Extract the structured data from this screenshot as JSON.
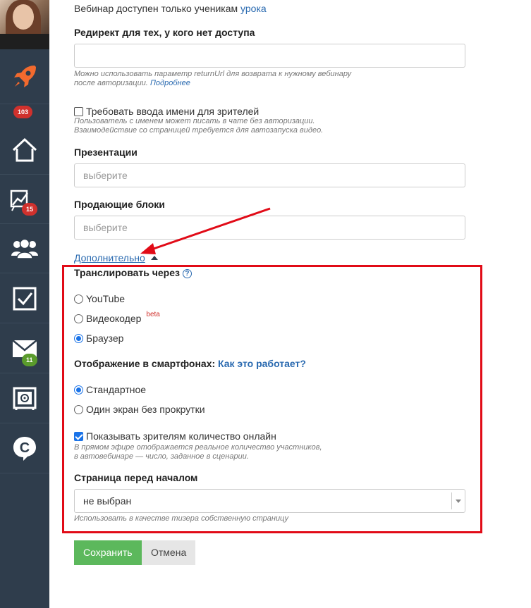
{
  "sidebar": {
    "badges": {
      "rocket": "103",
      "stats": "15",
      "mail": "11"
    },
    "icons": [
      "rocket-icon",
      "home-icon",
      "chart-icon",
      "users-icon",
      "checkbox-icon",
      "mail-icon",
      "safe-icon",
      "chat-c-icon"
    ]
  },
  "access": {
    "note_text": "Вебинар доступен только ученикам",
    "note_link": "урока"
  },
  "redirect": {
    "label": "Редирект для тех, у кого нет доступа",
    "value": "",
    "hint_line1": "Можно использовать параметр returnUrl для возврата к нужному вебинару",
    "hint_line2": "после авторизации.",
    "hint_link": "Подробнее"
  },
  "require_name": {
    "label": "Требовать ввода имени для зрителей",
    "checked": false,
    "hint_line1": "Пользователь с именем может писать в чате без авторизации.",
    "hint_line2": "Взаимодействие со страницей требуется для автозапуска видео."
  },
  "presentations": {
    "label": "Презентации",
    "placeholder": "выберите"
  },
  "selling_blocks": {
    "label": "Продающие блоки",
    "placeholder": "выберите"
  },
  "advanced_toggle": "Дополнительно",
  "broadcast": {
    "label": "Транслировать через",
    "help": "?",
    "options": [
      {
        "label": "YouTube",
        "selected": false
      },
      {
        "label": "Видеокодер",
        "badge": "beta",
        "selected": false
      },
      {
        "label": "Браузер",
        "selected": true
      }
    ]
  },
  "mobile": {
    "label": "Отображение в смартфонах:",
    "link": "Как это работает?",
    "options": [
      {
        "label": "Стандартное",
        "selected": true
      },
      {
        "label": "Один экран без прокрутки",
        "selected": false
      }
    ]
  },
  "show_online": {
    "label": "Показывать зрителям количество онлайн",
    "checked": true,
    "hint_line1": "В прямом эфире отображается реальное количество участников,",
    "hint_line2": "в автовебинаре — число, заданное в сценарии."
  },
  "pre_page": {
    "label": "Страница перед началом",
    "value": "не выбран",
    "hint": "Использовать в качестве тизера собственную страницу"
  },
  "buttons": {
    "save": "Сохранить",
    "cancel": "Отмена"
  },
  "colors": {
    "sidebar": "#2f3d4c",
    "accent_link": "#2a6ab0",
    "highlight_box": "#e10b17",
    "save_button": "#5cb85c"
  }
}
